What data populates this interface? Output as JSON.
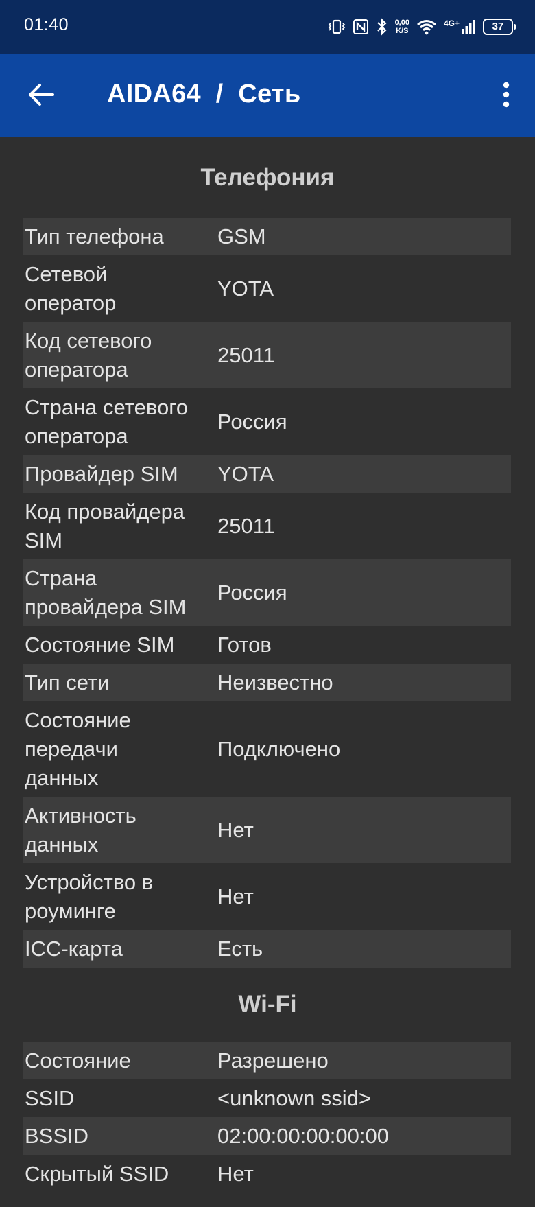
{
  "status_bar": {
    "time": "01:40",
    "net_speed_value": "0,00",
    "net_speed_unit": "K/S",
    "network_type": "4G+",
    "battery": "37"
  },
  "app_bar": {
    "title": "AIDA64  /  Сеть"
  },
  "telephony": {
    "title": "Телефония",
    "rows": [
      {
        "label": "Тип телефона",
        "value": "GSM"
      },
      {
        "label": "Сетевой оператор",
        "value": "YOTA"
      },
      {
        "label": "Код сетевого оператора",
        "value": "25011"
      },
      {
        "label": "Страна сетевого оператора",
        "value": "Россия"
      },
      {
        "label": "Провайдер SIM",
        "value": "YOTA"
      },
      {
        "label": "Код провайдера SIM",
        "value": "25011"
      },
      {
        "label": "Страна провайдера SIM",
        "value": "Россия"
      },
      {
        "label": "Состояние SIM",
        "value": "Готов"
      },
      {
        "label": "Тип сети",
        "value": "Неизвестно"
      },
      {
        "label": "Состояние передачи данных",
        "value": "Подключено"
      },
      {
        "label": "Активность данных",
        "value": "Нет"
      },
      {
        "label": "Устройство в роуминге",
        "value": "Нет"
      },
      {
        "label": "ICC-карта",
        "value": "Есть"
      }
    ]
  },
  "wifi": {
    "title": "Wi-Fi",
    "rows": [
      {
        "label": "Состояние",
        "value": "Разрешено"
      },
      {
        "label": "SSID",
        "value": "<unknown ssid>"
      },
      {
        "label": "BSSID",
        "value": "02:00:00:00:00:00"
      },
      {
        "label": "Скрытый SSID",
        "value": "Нет"
      }
    ]
  },
  "colors": {
    "status_bar_bg": "#0b2a5e",
    "app_bar_bg": "#0d47a1",
    "page_bg": "#2f2f2f",
    "row_alt_bg": "#3d3d3d"
  }
}
